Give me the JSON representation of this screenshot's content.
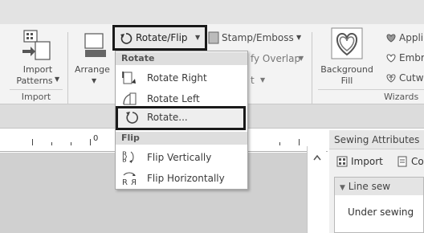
{
  "ribbon": {
    "import_patterns_label_1": "Import",
    "import_patterns_label_2": "Patterns",
    "arrange_label": "Arrange",
    "rotate_flip_label": "Rotate/Flip",
    "stamp_emboss_label": "Stamp/Emboss",
    "overlap_label": "fy Overlap",
    "t_label": "t",
    "background_fill_label_1": "Background",
    "background_fill_label_2": "Fill",
    "appli_label": "Appli",
    "embr_label": "Embr",
    "cutw_label": "Cutw",
    "groups": {
      "import": "Import",
      "wizards": "Wizards"
    }
  },
  "dropdown_menu": {
    "sections": [
      {
        "header": "Rotate",
        "items": [
          {
            "label": "Rotate Right",
            "icon": "rotate-right-icon"
          },
          {
            "label": "Rotate Left",
            "icon": "rotate-left-icon"
          },
          {
            "label": "Rotate...",
            "icon": "rotate-icon",
            "highlighted": true
          }
        ]
      },
      {
        "header": "Flip",
        "items": [
          {
            "label": "Flip Vertically",
            "icon": "flip-vertically-icon"
          },
          {
            "label": "Flip Horizontally",
            "icon": "flip-horizontally-icon"
          }
        ]
      }
    ]
  },
  "ruler": {
    "zero_label": "0"
  },
  "sewing_attributes": {
    "title": "Sewing Attributes",
    "import_label": "Import",
    "co_label": "Co",
    "line_sew_label": "Line sew",
    "under_sewing_label": "Under sewing"
  }
}
